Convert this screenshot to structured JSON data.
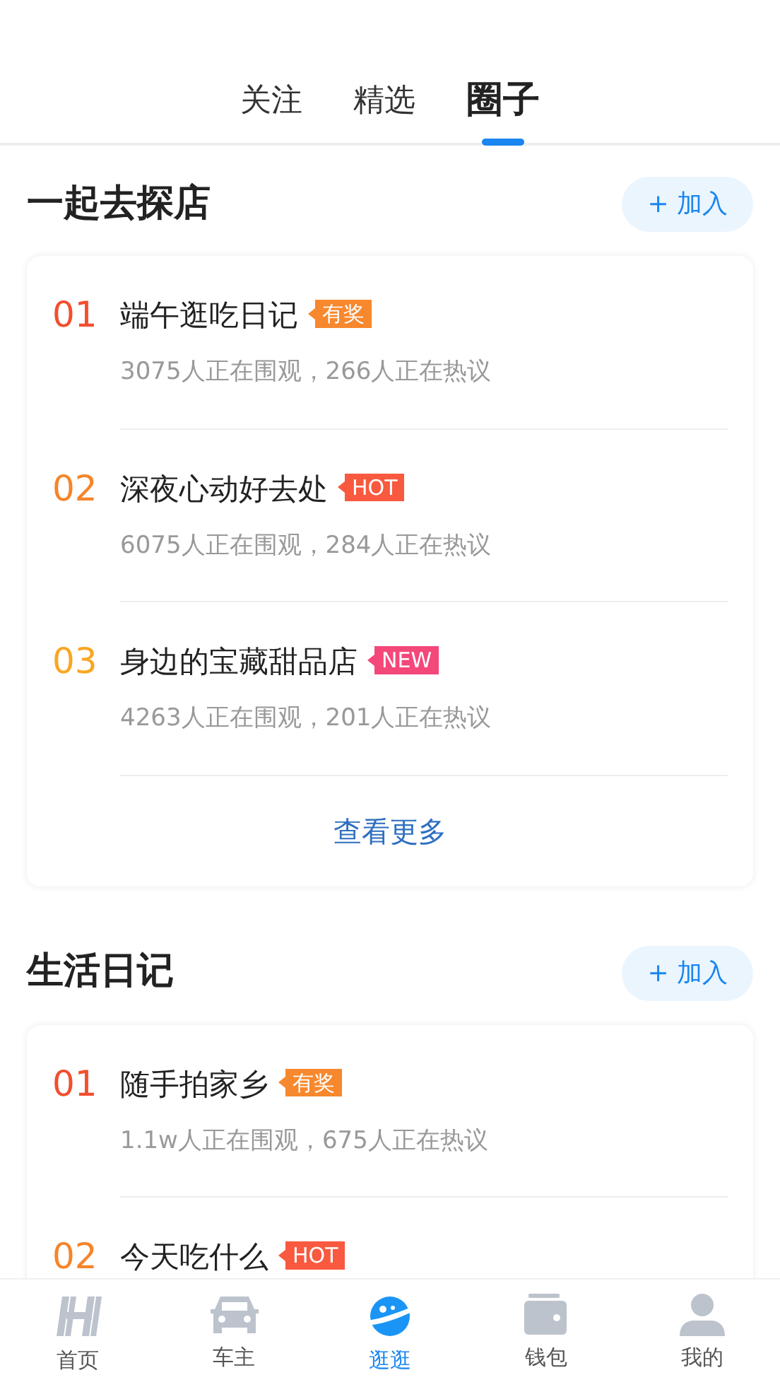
{
  "tabs": [
    {
      "label": "关注",
      "selected": false
    },
    {
      "label": "精选",
      "selected": false
    },
    {
      "label": "圈子",
      "selected": true
    }
  ],
  "sections": [
    {
      "title": "一起去探店",
      "join_button": "+ 加入",
      "items": [
        {
          "rank": "01",
          "title": "端午逛吃日记",
          "tag": {
            "kind": "prize",
            "label": "有奖"
          },
          "stats": "3075人正在围观，266人正在热议"
        },
        {
          "rank": "02",
          "title": "深夜心动好去处",
          "tag": {
            "kind": "hot",
            "label": "HOT"
          },
          "stats": "6075人正在围观，284人正在热议"
        },
        {
          "rank": "03",
          "title": "身边的宝藏甜品店",
          "tag": {
            "kind": "new",
            "label": "NEW"
          },
          "stats": "4263人正在围观，201人正在热议"
        }
      ],
      "more_link": "查看更多"
    },
    {
      "title": "生活日记",
      "join_button": "+ 加入",
      "items": [
        {
          "rank": "01",
          "title": "随手拍家乡",
          "tag": {
            "kind": "prize",
            "label": "有奖"
          },
          "stats": "1.1w人正在围观，675人正在热议"
        },
        {
          "rank": "02",
          "title": "今天吃什么",
          "tag": {
            "kind": "hot",
            "label": "HOT"
          }
        }
      ]
    }
  ],
  "bottom_nav": [
    {
      "kind": "home",
      "label": "首页",
      "selected": false
    },
    {
      "kind": "car",
      "label": "车主",
      "selected": false
    },
    {
      "kind": "planet",
      "label": "逛逛",
      "selected": true
    },
    {
      "kind": "wallet",
      "label": "钱包",
      "selected": false
    },
    {
      "kind": "user",
      "label": "我的",
      "selected": false
    }
  ]
}
